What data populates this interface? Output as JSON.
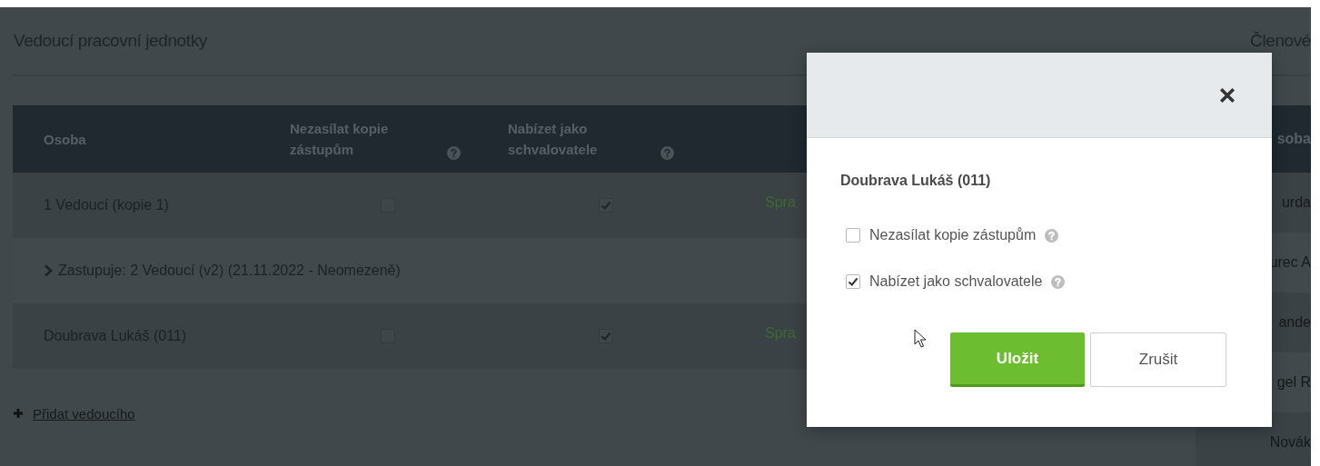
{
  "left_panel": {
    "title": "Vedoucí pracovní jednotky",
    "table": {
      "columns": [
        {
          "label": "Osoba",
          "help": false
        },
        {
          "label": "Nezasílat kopie zástupům",
          "help": true
        },
        {
          "label": "Nabízet jako schvalovatele",
          "help": true
        }
      ],
      "rows": [
        {
          "kind": "person",
          "name": "1 Vedoucí (kopie 1)",
          "no_copies": false,
          "offer_approver": true,
          "action": "Spra"
        },
        {
          "kind": "substitute",
          "text": "Zastupuje: 2 Vedoucí (v2) (21.11.2022 - Neomezeně)",
          "expanded": false
        },
        {
          "kind": "person",
          "name": "Doubrava Lukáš (011)",
          "no_copies": false,
          "offer_approver": true,
          "action": "Spra"
        }
      ]
    },
    "add_link": "Přidat vedoucího"
  },
  "right_panel": {
    "title": "Členové",
    "column": "soba",
    "rows": [
      "urda",
      "urec A",
      "ande",
      "gel R",
      "Novák"
    ]
  },
  "dialog": {
    "title": "Doubrava Lukáš (011)",
    "options": [
      {
        "label": "Nezasílat kopie zástupům",
        "checked": false,
        "help": true
      },
      {
        "label": "Nabízet jako schvalovatele",
        "checked": true,
        "help": true
      }
    ],
    "buttons": [
      {
        "label": "Uložit",
        "kind": "primary"
      },
      {
        "label": "Zrušit",
        "kind": "secondary"
      }
    ]
  }
}
